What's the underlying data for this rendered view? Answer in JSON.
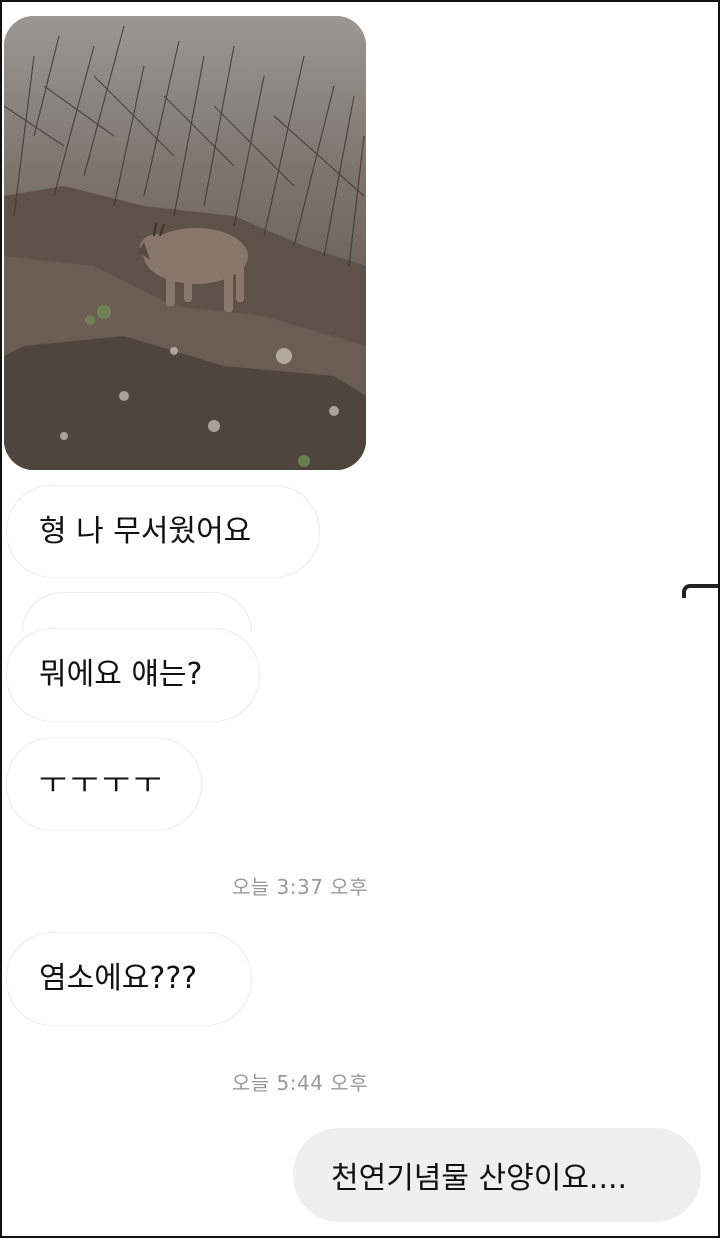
{
  "thread": {
    "photo": {
      "icon": "goral-photo",
      "colors": {
        "brush": "#7b7068",
        "animal": "#8a776b",
        "ground": "#5d5148"
      }
    },
    "messages": [
      {
        "direction": "incoming",
        "text": "형 나 무서웠어요"
      },
      {
        "direction": "incoming",
        "text": "뭐에요 얘는?"
      },
      {
        "direction": "incoming",
        "text": "ㅜㅜㅜㅜ"
      },
      {
        "direction": "incoming",
        "text": "염소에요???"
      },
      {
        "direction": "outgoing",
        "text": "천연기념물 산양이요...."
      }
    ],
    "timestamps": [
      "오늘 3:37 오후",
      "오늘 5:44 오후"
    ]
  }
}
